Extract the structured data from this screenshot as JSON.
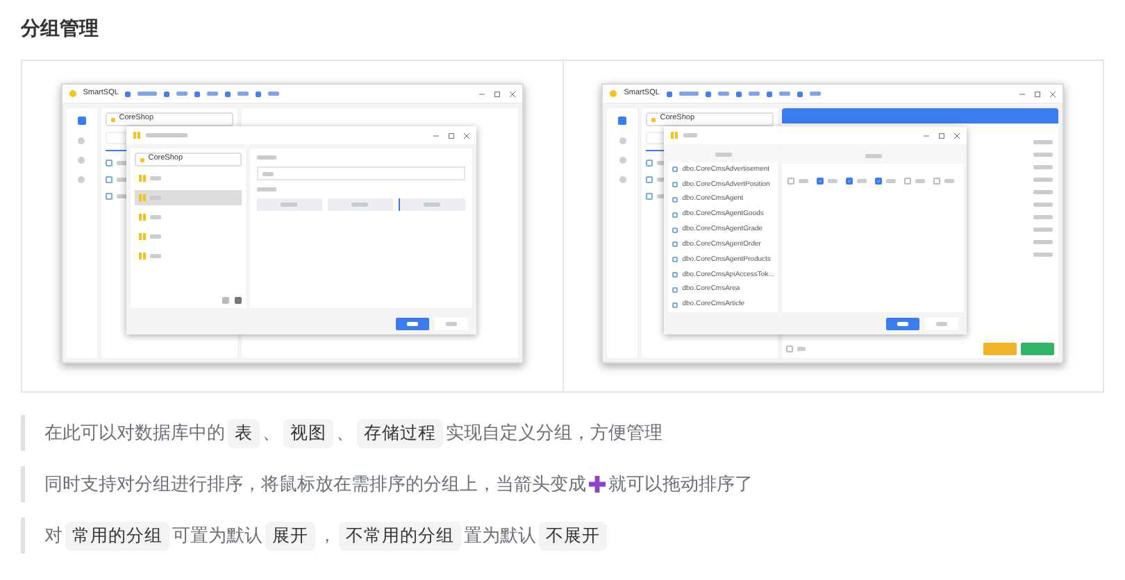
{
  "title": "分组管理",
  "screenshots": [
    {
      "kind": "group-editor",
      "app_name": "SmartSQL",
      "database": "CoreShop",
      "dialog_database": "CoreShop",
      "groups": [
        {
          "selected": false
        },
        {
          "selected": true
        },
        {
          "selected": false
        },
        {
          "selected": false
        },
        {
          "selected": false
        }
      ],
      "expand_options": [
        {
          "selected": false
        },
        {
          "selected": false
        },
        {
          "selected": true
        }
      ]
    },
    {
      "kind": "object-assign",
      "app_name": "SmartSQL",
      "database": "CoreShop",
      "objects": [
        "dbo.CoreCmsAdvertisement",
        "dbo.CoreCmsAdvertPosition",
        "dbo.CoreCmsAgent",
        "dbo.CoreCmsAgentGoods",
        "dbo.CoreCmsAgentGrade",
        "dbo.CoreCmsAgentOrder",
        "dbo.CoreCmsAgentProducts",
        "dbo.CoreCmsApiAccessTok...",
        "dbo.CoreCmsArea",
        "dbo.CoreCmsArticle"
      ],
      "footer_check": {
        "checked": false
      },
      "group_checks": [
        {
          "checked": false
        },
        {
          "checked": true
        },
        {
          "checked": true
        },
        {
          "checked": true
        },
        {
          "checked": false
        },
        {
          "checked": false
        }
      ]
    }
  ],
  "notes": [
    {
      "parts": [
        {
          "kind": "text",
          "text": "在此可以对数据库中的"
        },
        {
          "kind": "code",
          "text": "表"
        },
        {
          "kind": "text",
          "text": "、"
        },
        {
          "kind": "code",
          "text": "视图"
        },
        {
          "kind": "text",
          "text": "、"
        },
        {
          "kind": "code",
          "text": "存储过程"
        },
        {
          "kind": "text",
          "text": "实现自定义分组，方便管理"
        }
      ]
    },
    {
      "parts": [
        {
          "kind": "text",
          "text": "同时支持对分组进行排序，将鼠标放在需排序的分组上，当箭头变成"
        },
        {
          "kind": "icon"
        },
        {
          "kind": "text",
          "text": "就可以拖动排序了"
        }
      ]
    },
    {
      "parts": [
        {
          "kind": "text",
          "text": "对"
        },
        {
          "kind": "code",
          "text": "常用的分组"
        },
        {
          "kind": "text",
          "text": "可置为默认"
        },
        {
          "kind": "code",
          "text": "展开"
        },
        {
          "kind": "text",
          "text": "，"
        },
        {
          "kind": "code",
          "text": "不常用的分组"
        },
        {
          "kind": "text",
          "text": "置为默认"
        },
        {
          "kind": "code",
          "text": "不展开"
        }
      ]
    }
  ]
}
